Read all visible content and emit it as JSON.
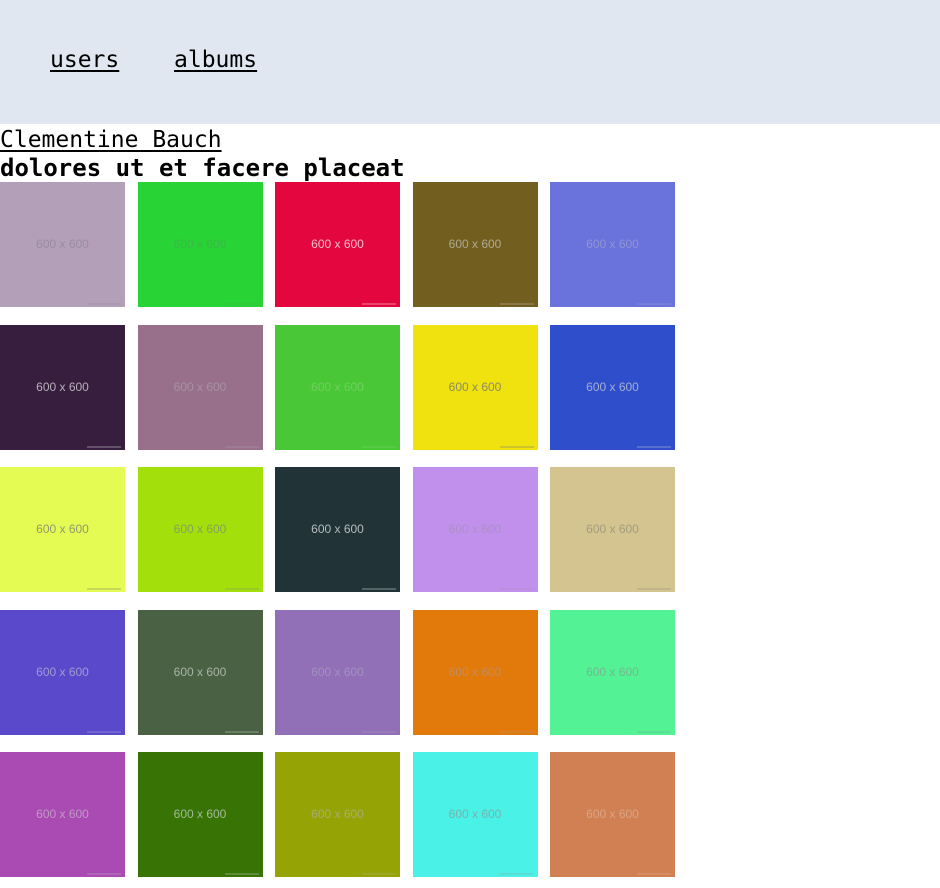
{
  "nav": {
    "users_label": "users",
    "albums_label": "albums",
    "background": "#e0e7f0"
  },
  "album": {
    "user_name": "Clementine Bauch",
    "title": "dolores ut et facere placeat"
  },
  "photos": [
    {
      "label": "600 x 600",
      "color": "#b3a0b8",
      "text_color": "#9a8ca0"
    },
    {
      "label": "600 x 600",
      "color": "#28d435",
      "text_color": "#3ab846"
    },
    {
      "label": "600 x 600",
      "color": "#e3063f",
      "text_color": "#f0c0cc"
    },
    {
      "label": "600 x 600",
      "color": "#725f20",
      "text_color": "#b0a890"
    },
    {
      "label": "600 x 600",
      "color": "#6a72db",
      "text_color": "#8e95d6"
    },
    {
      "label": "600 x 600",
      "color": "#371e3e",
      "text_color": "#b8b0ba"
    },
    {
      "label": "600 x 600",
      "color": "#98708c",
      "text_color": "#a892a4"
    },
    {
      "label": "600 x 600",
      "color": "#4ac737",
      "text_color": "#6ed05e"
    },
    {
      "label": "600 x 600",
      "color": "#efe20e",
      "text_color": "#8e8a62"
    },
    {
      "label": "600 x 600",
      "color": "#2e4ecc",
      "text_color": "#a4aed0"
    },
    {
      "label": "600 x 600",
      "color": "#e3fb52",
      "text_color": "#8f9a6c"
    },
    {
      "label": "600 x 600",
      "color": "#a3e00b",
      "text_color": "#86a05a"
    },
    {
      "label": "600 x 600",
      "color": "#223338",
      "text_color": "#b4bcbe"
    },
    {
      "label": "600 x 600",
      "color": "#c190ec",
      "text_color": "#ab90c6"
    },
    {
      "label": "600 x 600",
      "color": "#d4c48f",
      "text_color": "#a49c80"
    },
    {
      "label": "600 x 600",
      "color": "#5b49cc",
      "text_color": "#a09ad0"
    },
    {
      "label": "600 x 600",
      "color": "#4a6144",
      "text_color": "#a8b4a6"
    },
    {
      "label": "600 x 600",
      "color": "#9170b8",
      "text_color": "#a390be"
    },
    {
      "label": "600 x 600",
      "color": "#e2790b",
      "text_color": "#c08c5c"
    },
    {
      "label": "600 x 600",
      "color": "#52f295",
      "text_color": "#74b88e"
    },
    {
      "label": "600 x 600",
      "color": "#a94bb2",
      "text_color": "#c098c4"
    },
    {
      "label": "600 x 600",
      "color": "#377305",
      "text_color": "#a4ba96"
    },
    {
      "label": "600 x 600",
      "color": "#96a305",
      "text_color": "#a8ae6e"
    },
    {
      "label": "600 x 600",
      "color": "#4af1e6",
      "text_color": "#74b4b0"
    },
    {
      "label": "600 x 600",
      "color": "#d08053",
      "text_color": "#dba484"
    }
  ]
}
